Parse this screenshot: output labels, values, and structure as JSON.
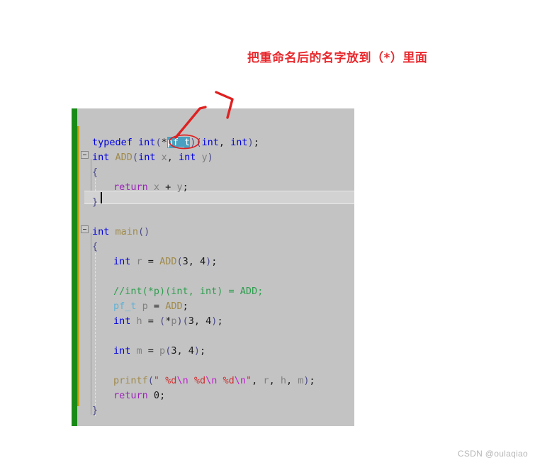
{
  "annotation": {
    "title": "把重命名后的名字放到（*）里面",
    "title_color": "#e8282d",
    "arrow_color": "#e02020",
    "circled_token": "pf_t"
  },
  "editor": {
    "background_color": "#c3c3c3",
    "change_bar_saved_color": "#1a8a17",
    "change_bar_modified_color": "#c8a11a",
    "current_line_number": 5,
    "selection_token": "pf_t",
    "fold_markers": [
      "-",
      "-"
    ],
    "lines": [
      {
        "n": 1,
        "indent": 0,
        "tokens": [
          {
            "t": "typedef",
            "c": "kw"
          },
          {
            "t": " ",
            "c": "plain"
          },
          {
            "t": "int",
            "c": "kw"
          },
          {
            "t": "(",
            "c": "punct"
          },
          {
            "t": "*",
            "c": "num"
          },
          {
            "t": "pf_t",
            "c": "sel"
          },
          {
            "t": ")",
            "c": "punct"
          },
          {
            "t": "(",
            "c": "punct"
          },
          {
            "t": "int",
            "c": "kw"
          },
          {
            "t": ", ",
            "c": "num"
          },
          {
            "t": "int",
            "c": "kw"
          },
          {
            "t": ")",
            "c": "punct"
          },
          {
            "t": ";",
            "c": "num"
          }
        ]
      },
      {
        "n": 2,
        "indent": 0,
        "tokens": [
          {
            "t": "int",
            "c": "kw"
          },
          {
            "t": " ",
            "c": "plain"
          },
          {
            "t": "ADD",
            "c": "fn"
          },
          {
            "t": "(",
            "c": "punct"
          },
          {
            "t": "int",
            "c": "kw"
          },
          {
            "t": " x",
            "c": "plain"
          },
          {
            "t": ", ",
            "c": "num"
          },
          {
            "t": "int",
            "c": "kw"
          },
          {
            "t": " y",
            "c": "plain"
          },
          {
            "t": ")",
            "c": "punct"
          }
        ]
      },
      {
        "n": 3,
        "indent": 0,
        "tokens": [
          {
            "t": "{",
            "c": "punct"
          }
        ]
      },
      {
        "n": 4,
        "indent": 1,
        "tokens": [
          {
            "t": "return",
            "c": "ret"
          },
          {
            "t": " x ",
            "c": "plain"
          },
          {
            "t": "+",
            "c": "num"
          },
          {
            "t": " y",
            "c": "plain"
          },
          {
            "t": ";",
            "c": "num"
          }
        ]
      },
      {
        "n": 5,
        "indent": 0,
        "tokens": [
          {
            "t": "}",
            "c": "punct"
          }
        ]
      },
      {
        "n": 6,
        "indent": 0,
        "tokens": []
      },
      {
        "n": 7,
        "indent": 0,
        "tokens": [
          {
            "t": "int",
            "c": "kw"
          },
          {
            "t": " ",
            "c": "plain"
          },
          {
            "t": "main",
            "c": "fn"
          },
          {
            "t": "()",
            "c": "punct"
          }
        ]
      },
      {
        "n": 8,
        "indent": 0,
        "tokens": [
          {
            "t": "{",
            "c": "punct"
          }
        ]
      },
      {
        "n": 9,
        "indent": 1,
        "tokens": [
          {
            "t": "int",
            "c": "kw"
          },
          {
            "t": " r ",
            "c": "plain"
          },
          {
            "t": "=",
            "c": "num"
          },
          {
            "t": " ",
            "c": "plain"
          },
          {
            "t": "ADD",
            "c": "fn"
          },
          {
            "t": "(",
            "c": "punct"
          },
          {
            "t": "3",
            "c": "num"
          },
          {
            "t": ", ",
            "c": "num"
          },
          {
            "t": "4",
            "c": "num"
          },
          {
            "t": ")",
            "c": "punct"
          },
          {
            "t": ";",
            "c": "num"
          }
        ]
      },
      {
        "n": 10,
        "indent": 0,
        "tokens": []
      },
      {
        "n": 11,
        "indent": 1,
        "tokens": [
          {
            "t": "//int(*p)(int, int) = ADD;",
            "c": "cmt"
          }
        ]
      },
      {
        "n": 12,
        "indent": 1,
        "tokens": [
          {
            "t": "pf_t",
            "c": "typ"
          },
          {
            "t": " p ",
            "c": "plain"
          },
          {
            "t": "=",
            "c": "num"
          },
          {
            "t": " ",
            "c": "plain"
          },
          {
            "t": "ADD",
            "c": "fn"
          },
          {
            "t": ";",
            "c": "num"
          }
        ]
      },
      {
        "n": 13,
        "indent": 1,
        "tokens": [
          {
            "t": "int",
            "c": "kw"
          },
          {
            "t": " h ",
            "c": "plain"
          },
          {
            "t": "= ",
            "c": "num"
          },
          {
            "t": "(",
            "c": "punct"
          },
          {
            "t": "*",
            "c": "num"
          },
          {
            "t": "p",
            "c": "plain"
          },
          {
            "t": ")",
            "c": "punct"
          },
          {
            "t": "(",
            "c": "punct"
          },
          {
            "t": "3",
            "c": "num"
          },
          {
            "t": ", ",
            "c": "num"
          },
          {
            "t": "4",
            "c": "num"
          },
          {
            "t": ")",
            "c": "punct"
          },
          {
            "t": ";",
            "c": "num"
          }
        ]
      },
      {
        "n": 14,
        "indent": 0,
        "tokens": []
      },
      {
        "n": 15,
        "indent": 1,
        "tokens": [
          {
            "t": "int",
            "c": "kw"
          },
          {
            "t": " m ",
            "c": "plain"
          },
          {
            "t": "=",
            "c": "num"
          },
          {
            "t": " p",
            "c": "plain"
          },
          {
            "t": "(",
            "c": "punct"
          },
          {
            "t": "3",
            "c": "num"
          },
          {
            "t": ", ",
            "c": "num"
          },
          {
            "t": "4",
            "c": "num"
          },
          {
            "t": ")",
            "c": "punct"
          },
          {
            "t": ";",
            "c": "num"
          }
        ]
      },
      {
        "n": 16,
        "indent": 0,
        "tokens": []
      },
      {
        "n": 17,
        "indent": 1,
        "tokens": [
          {
            "t": "printf",
            "c": "fn"
          },
          {
            "t": "(",
            "c": "punct"
          },
          {
            "t": "\" %d",
            "c": "str"
          },
          {
            "t": "\\n",
            "c": "esc"
          },
          {
            "t": " %d",
            "c": "str"
          },
          {
            "t": "\\n",
            "c": "esc"
          },
          {
            "t": " %d",
            "c": "str"
          },
          {
            "t": "\\n",
            "c": "esc"
          },
          {
            "t": "\"",
            "c": "str"
          },
          {
            "t": ", ",
            "c": "num"
          },
          {
            "t": "r",
            "c": "plain"
          },
          {
            "t": ", ",
            "c": "num"
          },
          {
            "t": "h",
            "c": "plain"
          },
          {
            "t": ", ",
            "c": "num"
          },
          {
            "t": "m",
            "c": "plain"
          },
          {
            "t": ")",
            "c": "punct"
          },
          {
            "t": ";",
            "c": "num"
          }
        ]
      },
      {
        "n": 18,
        "indent": 1,
        "tokens": [
          {
            "t": "return",
            "c": "ret"
          },
          {
            "t": " ",
            "c": "plain"
          },
          {
            "t": "0",
            "c": "num"
          },
          {
            "t": ";",
            "c": "num"
          }
        ]
      },
      {
        "n": 19,
        "indent": 0,
        "tokens": [
          {
            "t": "}",
            "c": "punct"
          }
        ]
      }
    ]
  },
  "watermark": {
    "text": "CSDN @oulaqiao"
  }
}
